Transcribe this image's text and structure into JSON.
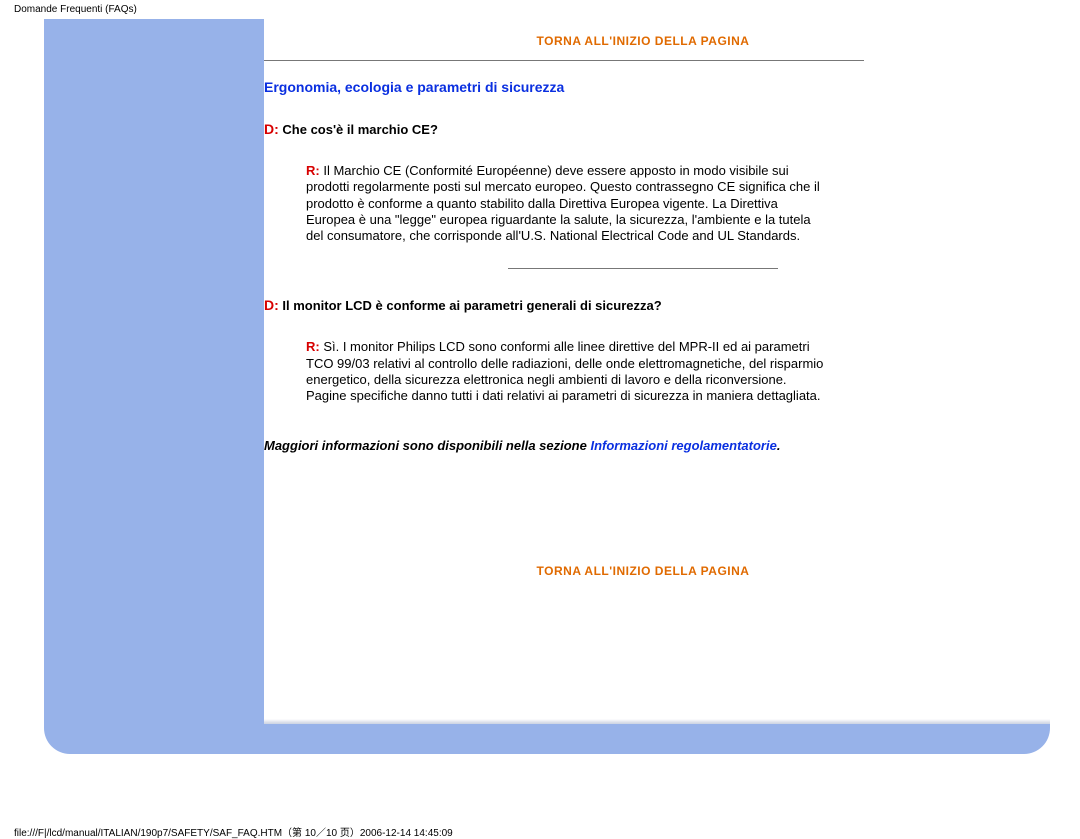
{
  "header": {
    "title": "Domande Frequenti (FAQs)"
  },
  "links": {
    "back_to_top": "TORNA ALL'INIZIO DELLA PAGINA"
  },
  "section": {
    "title": "Ergonomia, ecologia e parametri di sicurezza"
  },
  "qa": [
    {
      "d_prefix": "D:",
      "question": " Che cos'è il marchio CE?",
      "r_prefix": "R:",
      "answer": " Il Marchio CE (Conformité Européenne) deve essere apposto in modo visibile sui prodotti regolarmente posti sul mercato europeo. Questo contrassegno CE significa che il prodotto è conforme a quanto stabilito dalla Direttiva Europea vigente. La Direttiva Europea è una \"legge\" europea riguardante la salute, la sicurezza, l'ambiente e la tutela del consumatore, che corrisponde all'U.S. National Electrical Code and UL Standards."
    },
    {
      "d_prefix": "D:",
      "question": " Il monitor LCD è conforme ai parametri generali di sicurezza?",
      "r_prefix": "R:",
      "answer": " Sì. I monitor Philips LCD sono conformi alle linee direttive del MPR-II ed ai parametri TCO 99/03 relativi al controllo delle radiazioni, delle onde elettromagnetiche, del risparmio energetico, della sicurezza elettronica negli ambienti di lavoro e della riconversione. Pagine specifiche danno tutti i dati relativi ai parametri di sicurezza in maniera dettagliata."
    }
  ],
  "more_info": {
    "lead": "Maggiori informazioni sono disponibili nella sezione ",
    "link_text": "Informazioni regolamentatorie",
    "suffix": "."
  },
  "footer": {
    "path": "file:///F|/lcd/manual/ITALIAN/190p7/SAFETY/SAF_FAQ.HTM（第 10／10 页）2006-12-14 14:45:09"
  }
}
